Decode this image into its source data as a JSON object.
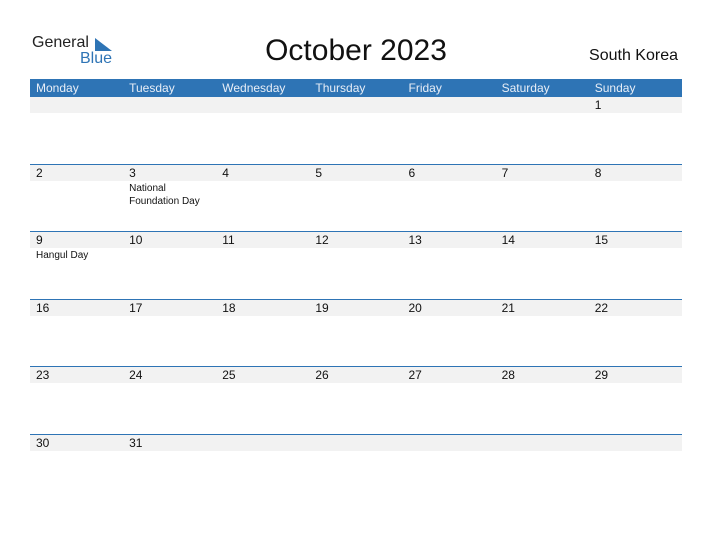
{
  "logo": {
    "general": "General",
    "blue": "Blue"
  },
  "header": {
    "title": "October 2023",
    "country": "South Korea"
  },
  "calendar": {
    "days_of_week": [
      "Monday",
      "Tuesday",
      "Wednesday",
      "Thursday",
      "Friday",
      "Saturday",
      "Sunday"
    ],
    "weeks": [
      {
        "days": [
          "",
          "",
          "",
          "",
          "",
          "",
          "1"
        ],
        "events": [
          "",
          "",
          "",
          "",
          "",
          "",
          ""
        ]
      },
      {
        "days": [
          "2",
          "3",
          "4",
          "5",
          "6",
          "7",
          "8"
        ],
        "events": [
          "",
          "National Foundation Day",
          "",
          "",
          "",
          "",
          ""
        ]
      },
      {
        "days": [
          "9",
          "10",
          "11",
          "12",
          "13",
          "14",
          "15"
        ],
        "events": [
          "Hangul Day",
          "",
          "",
          "",
          "",
          "",
          ""
        ]
      },
      {
        "days": [
          "16",
          "17",
          "18",
          "19",
          "20",
          "21",
          "22"
        ],
        "events": [
          "",
          "",
          "",
          "",
          "",
          "",
          ""
        ]
      },
      {
        "days": [
          "23",
          "24",
          "25",
          "26",
          "27",
          "28",
          "29"
        ],
        "events": [
          "",
          "",
          "",
          "",
          "",
          "",
          ""
        ]
      },
      {
        "days": [
          "30",
          "31",
          "",
          "",
          "",
          "",
          ""
        ],
        "events": [
          "",
          "",
          "",
          "",
          "",
          "",
          ""
        ]
      }
    ]
  },
  "colors": {
    "accent": "#2e74b5",
    "band": "#f2f2f2"
  }
}
